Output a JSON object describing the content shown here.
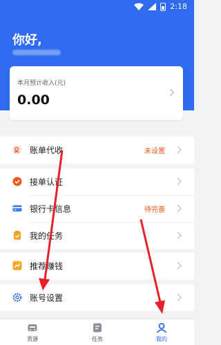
{
  "status_bar": {
    "time": "2:18"
  },
  "header": {
    "greeting": "你好,"
  },
  "income": {
    "label": "本月预计收入(元)",
    "value": "0.00"
  },
  "menu": {
    "bill_agent": {
      "label": "账单代收",
      "status": "未设置"
    },
    "order_cert": {
      "label": "接单认证"
    },
    "bank_card": {
      "label": "银行卡信息",
      "status": "待完善"
    },
    "my_tasks": {
      "label": "我的任务"
    },
    "referral": {
      "label": "推荐赚钱"
    },
    "account_settings": {
      "label": "账号设置"
    }
  },
  "tabbar": {
    "items": [
      {
        "label": "货源",
        "icon": "truck-icon"
      },
      {
        "label": "任务",
        "icon": "task-icon"
      },
      {
        "label": "我的",
        "icon": "user-icon",
        "active": true
      }
    ]
  },
  "colors": {
    "accent": "#2f6bf0",
    "status_orange": "#f05a1a",
    "annotation_red": "#e8202a"
  }
}
